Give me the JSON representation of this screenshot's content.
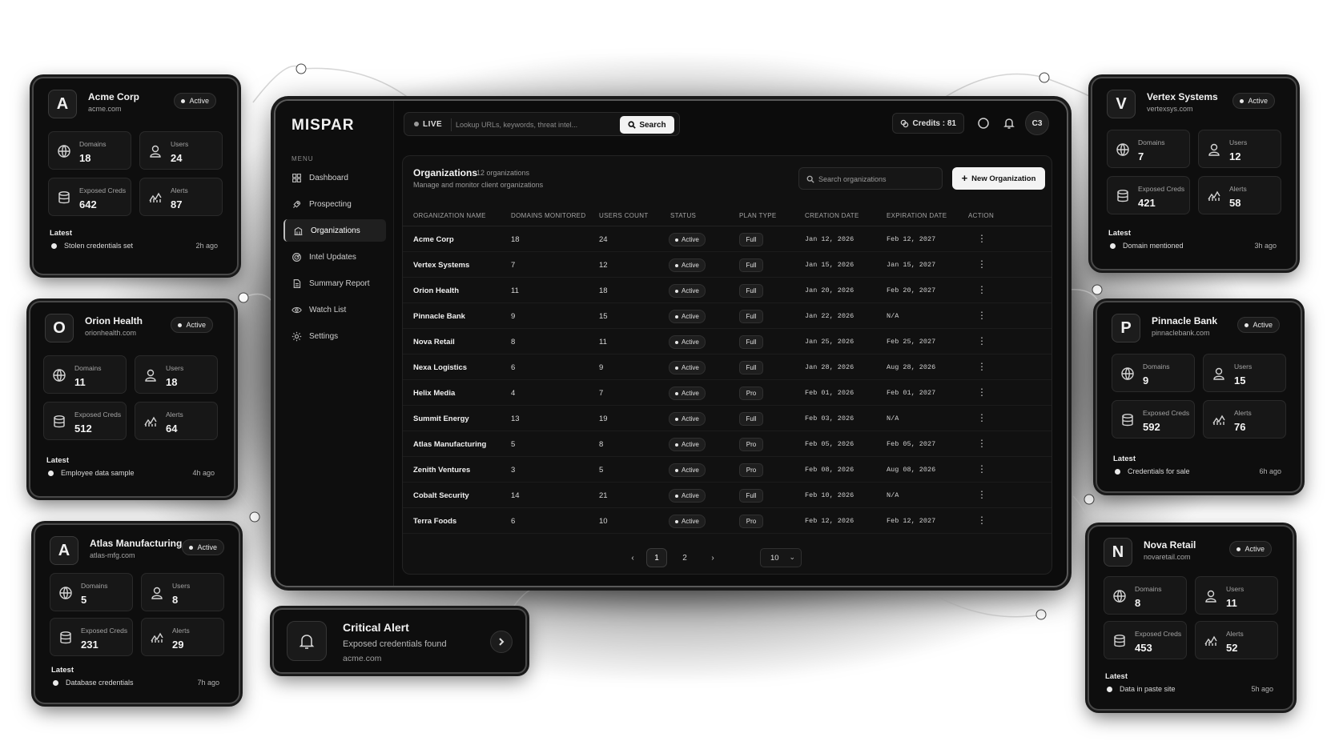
{
  "app": {
    "logo": "MISPAR",
    "menu_label": "MENU",
    "nav": [
      {
        "label": "Dashboard",
        "icon": "grid-icon"
      },
      {
        "label": "Prospecting",
        "icon": "rocket-icon"
      },
      {
        "label": "Organizations",
        "icon": "building-icon",
        "active": true
      },
      {
        "label": "Intel Updates",
        "icon": "radar-icon"
      },
      {
        "label": "Summary Report",
        "icon": "document-icon"
      },
      {
        "label": "Watch List",
        "icon": "eye-icon"
      },
      {
        "label": "Settings",
        "icon": "gear-icon"
      }
    ]
  },
  "topbar": {
    "live_label": "LIVE",
    "search_placeholder": "Lookup URLs, keywords, threat intel...",
    "search_button": "Search",
    "credits": "Credits : 81",
    "avatar": "C3"
  },
  "organizations": {
    "title": "Organizations",
    "count": "12 organizations",
    "subtitle": "Manage and monitor client organizations",
    "search_placeholder": "Search organizations",
    "new_button": "New Organization",
    "columns": [
      "ORGANIZATION NAME",
      "DOMAINS MONITORED",
      "USERS COUNT",
      "STATUS",
      "PLAN TYPE",
      "CREATION DATE",
      "EXPIRATION DATE",
      "ACTION"
    ],
    "rows": [
      {
        "name": "Acme Corp",
        "domains": "18",
        "users": "24",
        "status": "Active",
        "plan": "Full",
        "created": "Jan 12, 2026",
        "expires": "Feb 12, 2027"
      },
      {
        "name": "Vertex Systems",
        "domains": "7",
        "users": "12",
        "status": "Active",
        "plan": "Full",
        "created": "Jan 15, 2026",
        "expires": "Jan 15, 2027"
      },
      {
        "name": "Orion Health",
        "domains": "11",
        "users": "18",
        "status": "Active",
        "plan": "Full",
        "created": "Jan 20, 2026",
        "expires": "Feb 20, 2027"
      },
      {
        "name": "Pinnacle Bank",
        "domains": "9",
        "users": "15",
        "status": "Active",
        "plan": "Full",
        "created": "Jan 22, 2026",
        "expires": "N/A"
      },
      {
        "name": "Nova Retail",
        "domains": "8",
        "users": "11",
        "status": "Active",
        "plan": "Full",
        "created": "Jan 25, 2026",
        "expires": "Feb 25, 2027"
      },
      {
        "name": "Nexa Logistics",
        "domains": "6",
        "users": "9",
        "status": "Active",
        "plan": "Full",
        "created": "Jan 28, 2026",
        "expires": "Aug 28, 2026"
      },
      {
        "name": "Helix Media",
        "domains": "4",
        "users": "7",
        "status": "Active",
        "plan": "Pro",
        "created": "Feb 01, 2026",
        "expires": "Feb 01, 2027"
      },
      {
        "name": "Summit Energy",
        "domains": "13",
        "users": "19",
        "status": "Active",
        "plan": "Full",
        "created": "Feb 03, 2026",
        "expires": "N/A"
      },
      {
        "name": "Atlas Manufacturing",
        "domains": "5",
        "users": "8",
        "status": "Active",
        "plan": "Pro",
        "created": "Feb 05, 2026",
        "expires": "Feb 05, 2027"
      },
      {
        "name": "Zenith Ventures",
        "domains": "3",
        "users": "5",
        "status": "Active",
        "plan": "Pro",
        "created": "Feb 08, 2026",
        "expires": "Aug 08, 2026"
      },
      {
        "name": "Cobalt Security",
        "domains": "14",
        "users": "21",
        "status": "Active",
        "plan": "Full",
        "created": "Feb 10, 2026",
        "expires": "N/A"
      },
      {
        "name": "Terra Foods",
        "domains": "6",
        "users": "10",
        "status": "Active",
        "plan": "Pro",
        "created": "Feb 12, 2026",
        "expires": "Feb 12, 2027"
      }
    ],
    "pagination": {
      "prev": "‹",
      "pages": [
        "1",
        "2"
      ],
      "current": "1",
      "next": "›",
      "per_page": "10"
    }
  },
  "cards": [
    {
      "initial": "A",
      "name": "Acme Corp",
      "domain": "acme.com",
      "status": "Active",
      "domains_label": "Domains",
      "domains": "18",
      "users_label": "Users",
      "users": "24",
      "creds_label": "Exposed Creds",
      "creds": "642",
      "alerts_label": "Alerts",
      "alerts": "87",
      "latest_label": "Latest",
      "latest": "Stolen credentials set",
      "latest_time": "2h ago"
    },
    {
      "initial": "O",
      "name": "Orion Health",
      "domain": "orionhealth.com",
      "status": "Active",
      "domains_label": "Domains",
      "domains": "11",
      "users_label": "Users",
      "users": "18",
      "creds_label": "Exposed Creds",
      "creds": "512",
      "alerts_label": "Alerts",
      "alerts": "64",
      "latest_label": "Latest",
      "latest": "Employee data sample",
      "latest_time": "4h ago"
    },
    {
      "initial": "A",
      "name": "Atlas Manufacturing",
      "domain": "atlas-mfg.com",
      "status": "Active",
      "domains_label": "Domains",
      "domains": "5",
      "users_label": "Users",
      "users": "8",
      "creds_label": "Exposed Creds",
      "creds": "231",
      "alerts_label": "Alerts",
      "alerts": "29",
      "latest_label": "Latest",
      "latest": "Database credentials",
      "latest_time": "7h ago"
    },
    {
      "initial": "V",
      "name": "Vertex Systems",
      "domain": "vertexsys.com",
      "status": "Active",
      "domains_label": "Domains",
      "domains": "7",
      "users_label": "Users",
      "users": "12",
      "creds_label": "Exposed Creds",
      "creds": "421",
      "alerts_label": "Alerts",
      "alerts": "58",
      "latest_label": "Latest",
      "latest": "Domain mentioned",
      "latest_time": "3h ago"
    },
    {
      "initial": "P",
      "name": "Pinnacle Bank",
      "domain": "pinnaclebank.com",
      "status": "Active",
      "domains_label": "Domains",
      "domains": "9",
      "users_label": "Users",
      "users": "15",
      "creds_label": "Exposed Creds",
      "creds": "592",
      "alerts_label": "Alerts",
      "alerts": "76",
      "latest_label": "Latest",
      "latest": "Credentials for sale",
      "latest_time": "6h ago"
    },
    {
      "initial": "N",
      "name": "Nova Retail",
      "domain": "novaretail.com",
      "status": "Active",
      "domains_label": "Domains",
      "domains": "8",
      "users_label": "Users",
      "users": "11",
      "creds_label": "Exposed Creds",
      "creds": "453",
      "alerts_label": "Alerts",
      "alerts": "52",
      "latest_label": "Latest",
      "latest": "Data in paste site",
      "latest_time": "5h ago"
    }
  ],
  "alert": {
    "title": "Critical Alert",
    "description": "Exposed credentials found",
    "domain": "acme.com"
  }
}
